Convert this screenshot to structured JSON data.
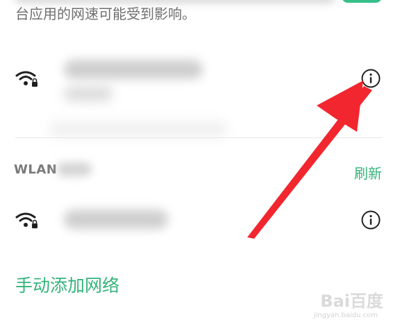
{
  "notice": {
    "line2": "台应用的网速可能受到影响。"
  },
  "saved_network": {
    "name": "",
    "icon": "wifi-lock-icon",
    "info_icon": "info-icon"
  },
  "wlan": {
    "section_label": "WLAN",
    "refresh_label": "刷新"
  },
  "available_network": {
    "name": "",
    "icon": "wifi-lock-icon",
    "info_icon": "info-icon"
  },
  "manual_add_label": "手动添加网络",
  "watermark": {
    "text": "Bai百度",
    "url": "jingyan.baidu.com"
  },
  "colors": {
    "accent": "#34b37a",
    "annotation_arrow": "#f2262f"
  }
}
